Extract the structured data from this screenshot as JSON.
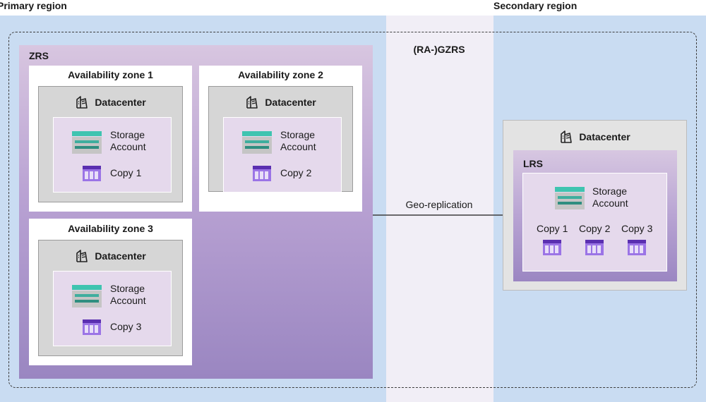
{
  "primary_region": {
    "label": "Primary region"
  },
  "secondary_region": {
    "label": "Secondary region"
  },
  "gzrs": {
    "label": "(RA-)GZRS"
  },
  "zrs": {
    "label": "ZRS",
    "zones": [
      {
        "title": "Availability zone 1",
        "datacenter": "Datacenter",
        "storage_line1": "Storage",
        "storage_line2": "Account",
        "copy": "Copy 1"
      },
      {
        "title": "Availability zone 2",
        "datacenter": "Datacenter",
        "storage_line1": "Storage",
        "storage_line2": "Account",
        "copy": "Copy 2"
      },
      {
        "title": "Availability zone 3",
        "datacenter": "Datacenter",
        "storage_line1": "Storage",
        "storage_line2": "Account",
        "copy": "Copy 3"
      }
    ]
  },
  "geo_replication": {
    "label": "Geo-replication"
  },
  "secondary": {
    "datacenter": "Datacenter",
    "lrs_label": "LRS",
    "storage_line1": "Storage",
    "storage_line2": "Account",
    "copies": [
      "Copy 1",
      "Copy 2",
      "Copy 3"
    ]
  },
  "colors": {
    "region_bg": "#c9dcf2",
    "zrs_purple": "#9a86c1",
    "storage_teal": "#3fc4b0",
    "copy_purple": "#7c4ed1"
  },
  "icons": [
    "datacenter-icon",
    "storage-account-icon",
    "copy-icon",
    "arrow-right-icon"
  ]
}
